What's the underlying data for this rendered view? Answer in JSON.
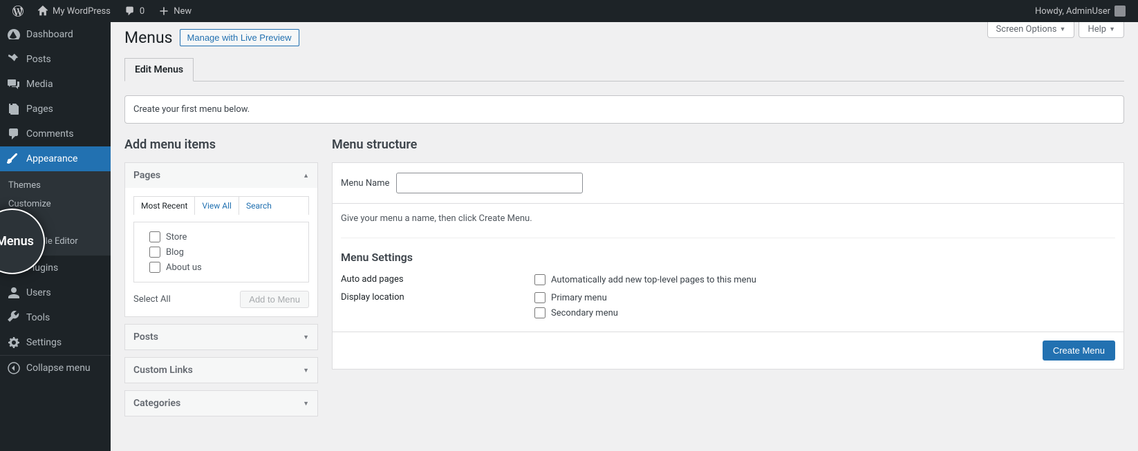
{
  "adminbar": {
    "site_name": "My WordPress",
    "comment_count": "0",
    "new_label": "New",
    "howdy": "Howdy, AdminUser"
  },
  "sidebar": {
    "items": [
      {
        "label": "Dashboard",
        "icon": "dashboard"
      },
      {
        "label": "Posts",
        "icon": "pin"
      },
      {
        "label": "Media",
        "icon": "media"
      },
      {
        "label": "Pages",
        "icon": "pages"
      },
      {
        "label": "Comments",
        "icon": "comment"
      },
      {
        "label": "Appearance",
        "icon": "brush",
        "active": true
      },
      {
        "label": "Plugins",
        "icon": "plugin"
      },
      {
        "label": "Users",
        "icon": "user"
      },
      {
        "label": "Tools",
        "icon": "wrench"
      },
      {
        "label": "Settings",
        "icon": "settings"
      }
    ],
    "submenu": [
      {
        "label": "Themes"
      },
      {
        "label": "Customize"
      },
      {
        "label": "Menus",
        "current": true
      },
      {
        "label": "Theme File Editor"
      }
    ],
    "collapse_label": "Collapse menu",
    "lens_label": "Menus"
  },
  "screen_meta": {
    "screen_options": "Screen Options",
    "help": "Help"
  },
  "page": {
    "title": "Menus",
    "header_action": "Manage with Live Preview",
    "tab": "Edit Menus",
    "notice": "Create your first menu below."
  },
  "add_menu": {
    "title": "Add menu items",
    "panels": {
      "pages": {
        "label": "Pages",
        "tabs": {
          "recent": "Most Recent",
          "view_all": "View All",
          "search": "Search"
        },
        "items": [
          "Store",
          "Blog",
          "About us"
        ],
        "select_all": "Select All",
        "add_button": "Add to Menu"
      },
      "posts": "Posts",
      "custom_links": "Custom Links",
      "categories": "Categories"
    }
  },
  "menu_structure": {
    "title": "Menu structure",
    "name_label": "Menu Name",
    "name_value": "",
    "hint": "Give your menu a name, then click Create Menu.",
    "settings_title": "Menu Settings",
    "auto_add": {
      "label": "Auto add pages",
      "option": "Automatically add new top-level pages to this menu"
    },
    "display": {
      "label": "Display location",
      "options": [
        "Primary menu",
        "Secondary menu"
      ]
    },
    "create_button": "Create Menu"
  }
}
